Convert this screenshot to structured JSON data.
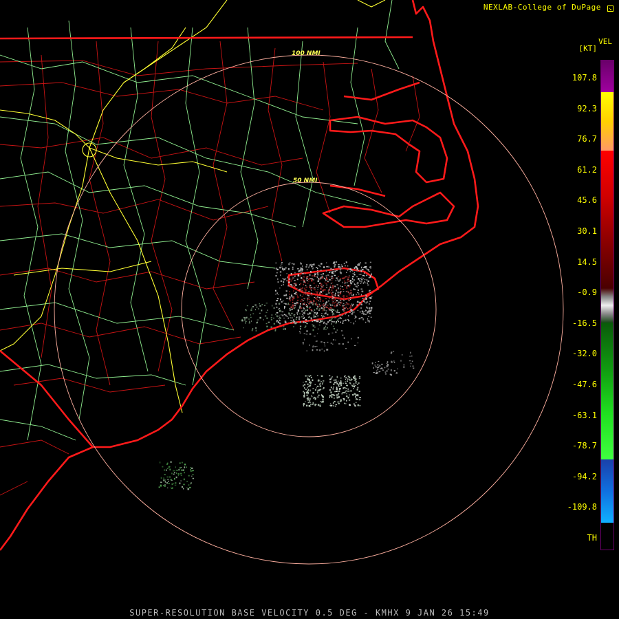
{
  "header": {
    "credit": "NEXLAB-College of DuPage",
    "credit_icon": "corner-arrow-icon"
  },
  "footer": {
    "caption": "SUPER-RESOLUTION BASE VELOCITY 0.5 DEG - KMHX 9 JAN 26 15:49"
  },
  "range_rings": [
    {
      "label": "100 NMI"
    },
    {
      "label": "50 NMI"
    }
  ],
  "legend": {
    "title": "VEL",
    "unit": "[KT]",
    "ticks": [
      "107.8",
      "92.3",
      "76.7",
      "61.2",
      "45.6",
      "30.1",
      "14.5",
      "-0.9",
      "-16.5",
      "-32.0",
      "-47.6",
      "-63.1",
      "-78.7",
      "-94.2",
      "-109.8",
      "TH"
    ]
  },
  "colors": {
    "background": "#000000",
    "state_borders": "#ff1a1a",
    "county_lines": "#c81414",
    "highways": "#90ee90",
    "interstates": "#ffff33",
    "range_rings": "#ffb0a0",
    "text": "#ffff00"
  }
}
